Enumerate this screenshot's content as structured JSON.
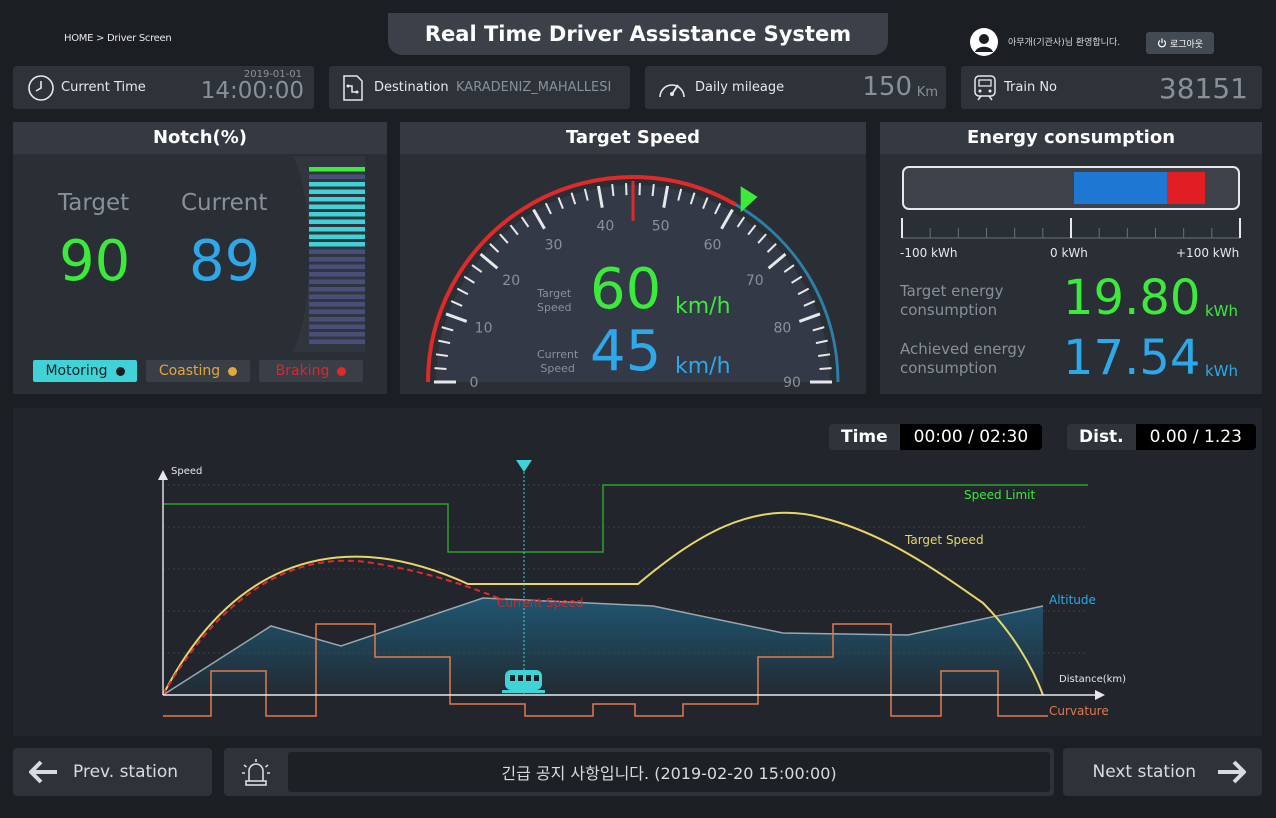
{
  "header": {
    "breadcrumb": "HOME > Driver Screen",
    "title": "Real Time Driver Assistance System",
    "welcome": "아무개(기관사)님 환영합니다.",
    "logout": "로그아웃"
  },
  "info": {
    "current_time_label": "Current Time",
    "date": "2019-01-01",
    "time": "14:00:00",
    "destination_label": "Destination",
    "destination": "KARADENIZ_MAHALLESI",
    "mileage_label": "Daily mileage",
    "mileage": "150",
    "mileage_unit": "Km",
    "train_label": "Train No",
    "train_no": "38151"
  },
  "notch": {
    "title": "Notch(%)",
    "target_label": "Target",
    "current_label": "Current",
    "target": "90",
    "current": "89",
    "target_pct": 90,
    "current_pct": 89,
    "modes": [
      "Motoring",
      "Coasting",
      "Braking"
    ]
  },
  "speed": {
    "title": "Target Speed",
    "target_label_1": "Target",
    "target_label_2": "Speed",
    "current_label_1": "Current",
    "current_label_2": "Speed",
    "target": "60",
    "current": "45",
    "unit": "km/h",
    "ticks": [
      "0",
      "10",
      "20",
      "30",
      "40",
      "50",
      "60",
      "70",
      "80",
      "90"
    ],
    "max": 90,
    "target_value": 60,
    "current_value": 45
  },
  "energy": {
    "title": "Energy consumption",
    "scale": [
      "-100 kWh",
      "0 kWh",
      "+100 kWh"
    ],
    "target_label_1": "Target energy",
    "target_label_2": "consumption",
    "achieved_label_1": "Achieved energy",
    "achieved_label_2": "consumption",
    "target": "19.80",
    "achieved": "17.54",
    "unit": "kWh"
  },
  "chart": {
    "time_label": "Time",
    "time_value": "00:00 / 02:30",
    "dist_label": "Dist.",
    "dist_value": "0.00 / 1.23",
    "y_label": "Speed",
    "x_label": "Distance(km)",
    "legend": {
      "speed_limit": "Speed Limit",
      "target_speed": "Target Speed",
      "current_speed": "Current Speed",
      "altitude": "Altitude",
      "curvature": "Curvature"
    }
  },
  "footer": {
    "prev": "Prev. station",
    "notice": "긴급 공지 사항입니다. (2019-02-20 15:00:00)",
    "next": "Next station"
  },
  "colors": {
    "green": "#3bea3b",
    "blue": "#2ea8e8",
    "red": "#e02a2a",
    "cyan": "#3fd2d6",
    "yellow": "#e8d66a",
    "orange": "#e07a4e"
  }
}
